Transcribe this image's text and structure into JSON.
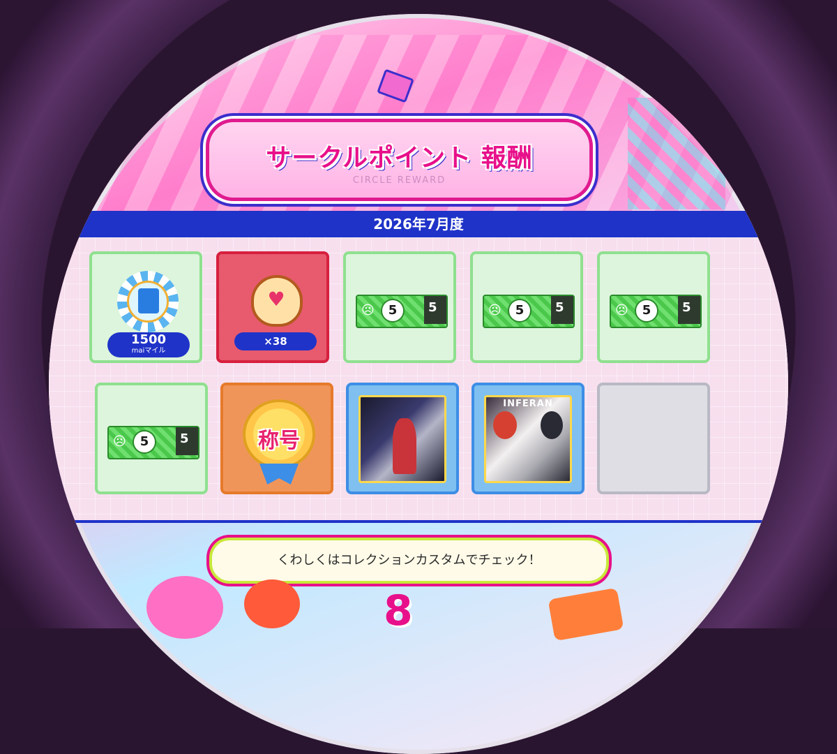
{
  "title": {
    "jp": "サークルポイント 報酬",
    "en": "CIRCLE REWARD"
  },
  "period": "2026年7月度",
  "rewards": [
    {
      "type": "mile",
      "icon": "mai-mile-chip-icon",
      "amount": "1500",
      "unit": "maiマイル"
    },
    {
      "type": "bag",
      "icon": "heart-bag-icon",
      "count": "×38"
    },
    {
      "type": "ticket",
      "icon": "ticket-icon",
      "value": "5"
    },
    {
      "type": "ticket",
      "icon": "ticket-icon",
      "value": "5"
    },
    {
      "type": "ticket",
      "icon": "ticket-icon",
      "value": "5"
    },
    {
      "type": "ticket",
      "icon": "ticket-icon",
      "value": "5"
    },
    {
      "type": "title",
      "icon": "title-medal-icon",
      "label": "称号"
    },
    {
      "type": "jacket",
      "icon": "song-jacket-icon"
    },
    {
      "type": "jacket",
      "icon": "song-jacket-icon",
      "logo": "INFERAN"
    },
    {
      "type": "empty"
    }
  ],
  "hint": "くわしくはコレクションカスタムでチェック！",
  "colors": {
    "accent_pink": "#e8108a",
    "month_bar_blue": "#1f33c8",
    "ticket_green": "#4bc84b"
  }
}
